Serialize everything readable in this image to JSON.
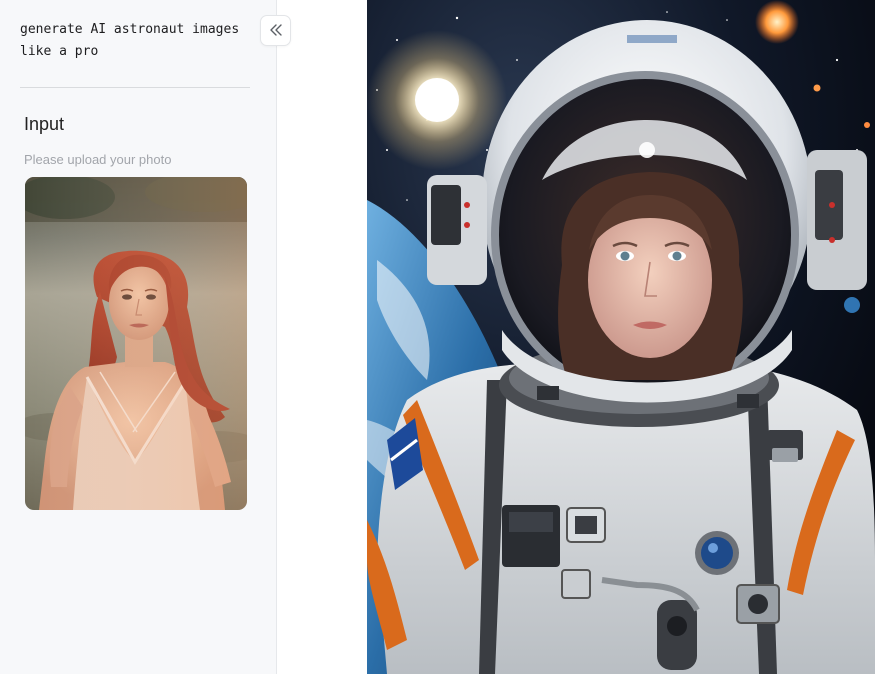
{
  "sidebar": {
    "title": "generate AI astronaut images\nlike a pro",
    "collapse_icon": "chevrons-left-icon",
    "input": {
      "heading": "Input",
      "hint": "Please upload your photo"
    },
    "uploaded_photo": "portrait of red-haired woman in white dress sitting on grass"
  },
  "result": {
    "image": "woman astronaut in white spacesuit floating in space above Earth"
  },
  "colors": {
    "sidebar_bg": "#f7f8fa",
    "divider": "#d9dbde",
    "hint_text": "#a2a5ab"
  }
}
